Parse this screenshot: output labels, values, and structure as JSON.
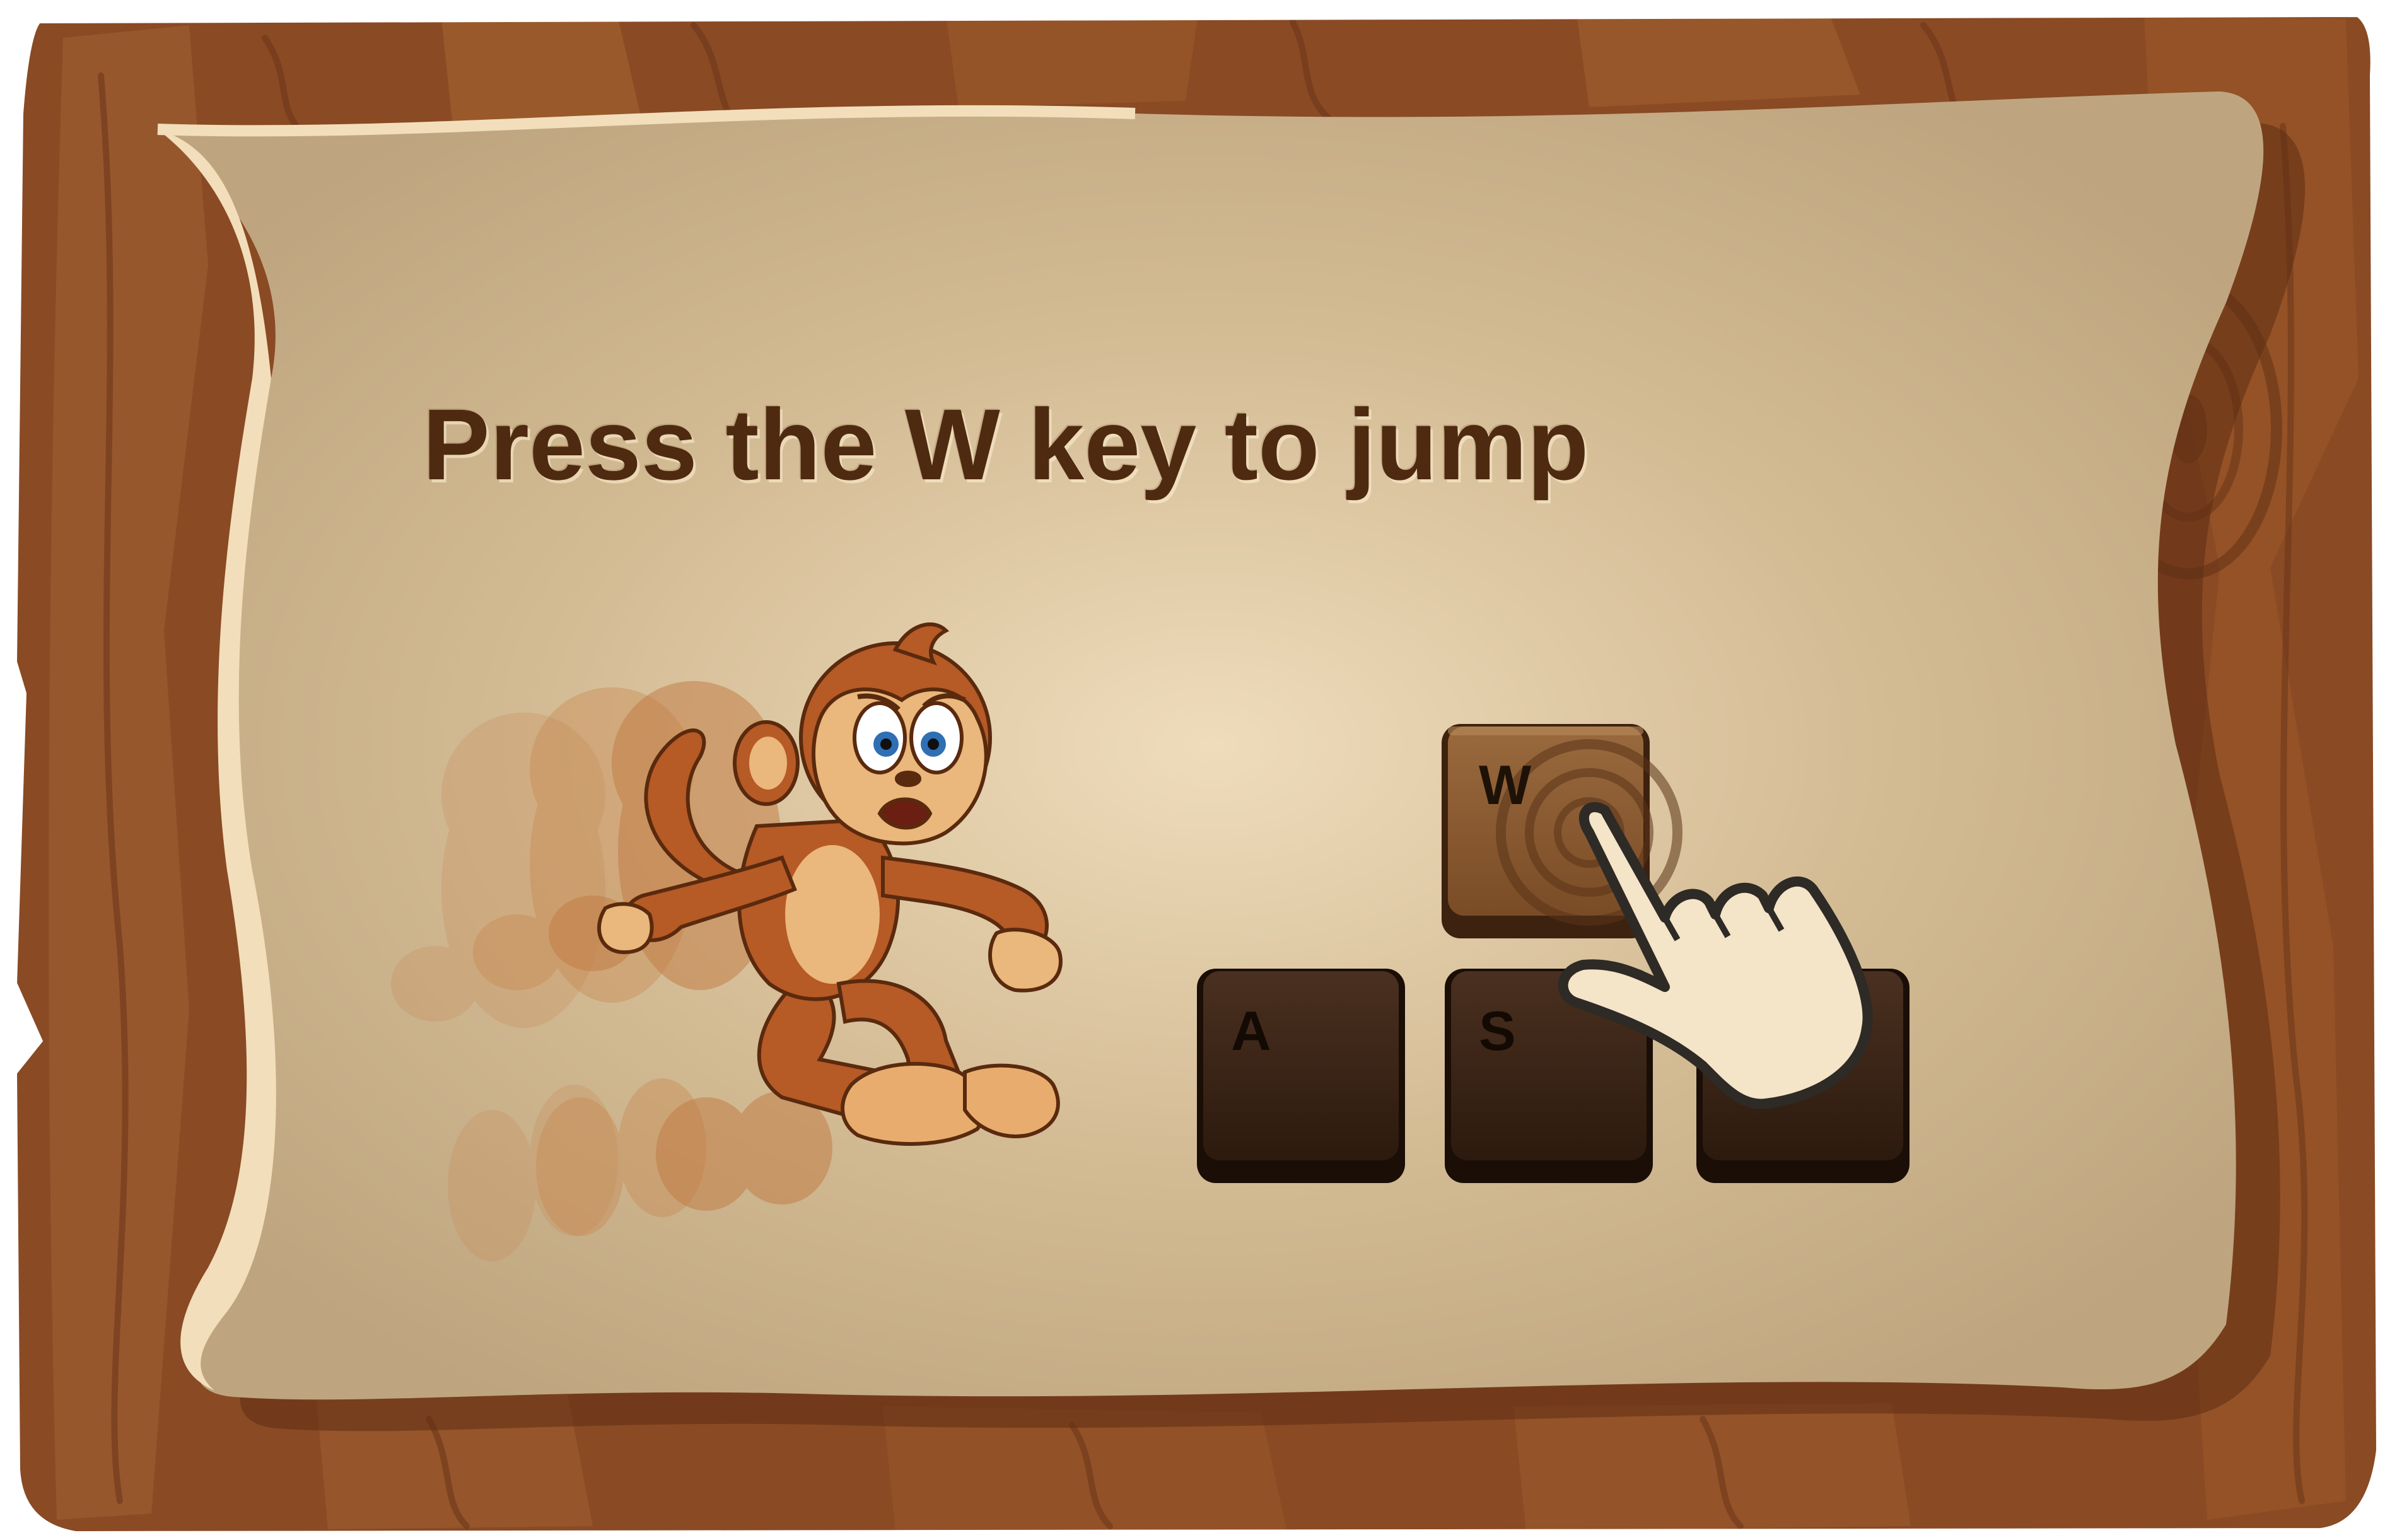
{
  "tutorial": {
    "instruction": "Press the W key to jump",
    "keys": {
      "w": "W",
      "a": "A",
      "s": "S",
      "d": ""
    },
    "highlighted_key": "W"
  },
  "icons": {
    "board": "wooden-board",
    "scroll": "parchment-scroll",
    "character": "monkey-running",
    "pointer": "pointing-hand-icon",
    "tap": "tap-ripple-icon"
  },
  "colors": {
    "wood": "#8a4a24",
    "wood_dark": "#5e2e14",
    "parchment": "#c9b088",
    "parchment_light": "#ecd5b1",
    "title": "#4e2a10",
    "key_dark": "#3a2414",
    "key_active": "#8a5a32",
    "monkey": "#b65a26",
    "monkey_face": "#eab77c",
    "hand": "#f4e4c8"
  }
}
